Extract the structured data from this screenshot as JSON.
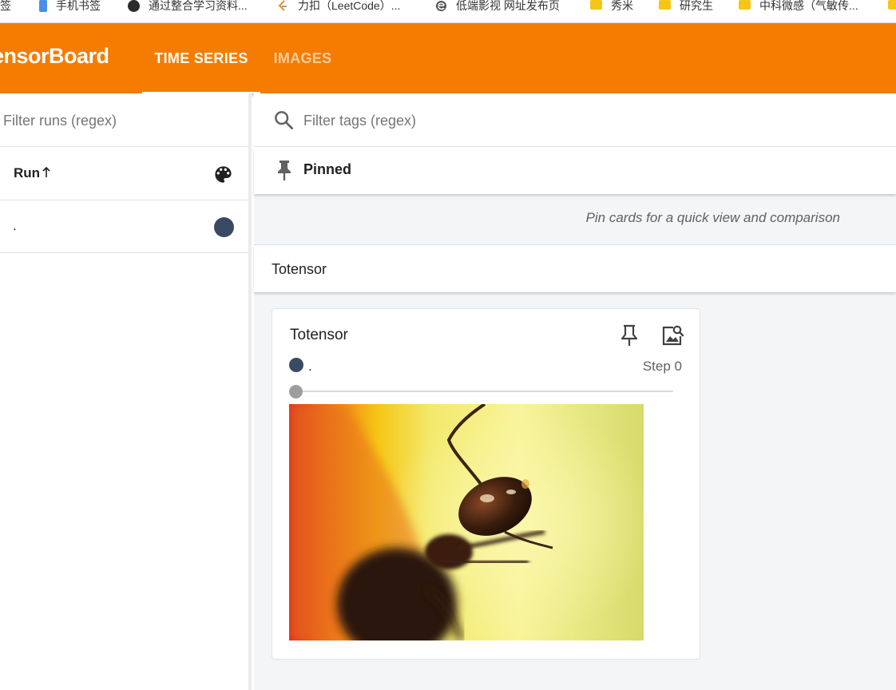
{
  "bookmarks": [
    {
      "label": "书签",
      "icon": "bookmark-icon"
    },
    {
      "label": "手机书签",
      "icon": "phone-icon"
    },
    {
      "label": "通过整合学习资料...",
      "icon": "site-icon"
    },
    {
      "label": "力扣（LeetCode）...",
      "icon": "leetcode-icon"
    },
    {
      "label": "低端影视 网址发布页",
      "icon": "site-icon"
    },
    {
      "label": "秀米",
      "icon": "folder-icon"
    },
    {
      "label": "研究生",
      "icon": "folder-icon"
    },
    {
      "label": "中科微感（气敏传...",
      "icon": "folder-icon"
    }
  ],
  "header": {
    "brand": "ensorBoard",
    "tabs": [
      {
        "label": "TIME SERIES",
        "active": true
      },
      {
        "label": "IMAGES",
        "active": false
      }
    ],
    "background_color": "#f57c00"
  },
  "sidebar": {
    "filter_placeholder": "Filter runs (regex)",
    "run_column_label": "Run",
    "runs": [
      {
        "name": ".",
        "color": "#3b4a63"
      }
    ]
  },
  "main": {
    "filter_placeholder": "Filter tags (regex)",
    "pinned_label": "Pinned",
    "pinned_hint": "Pin cards for a quick view and comparison",
    "group_name": "Totensor",
    "card": {
      "title": "Totensor",
      "run_name": ".",
      "step_label": "Step 0",
      "slider_value": 0
    }
  }
}
